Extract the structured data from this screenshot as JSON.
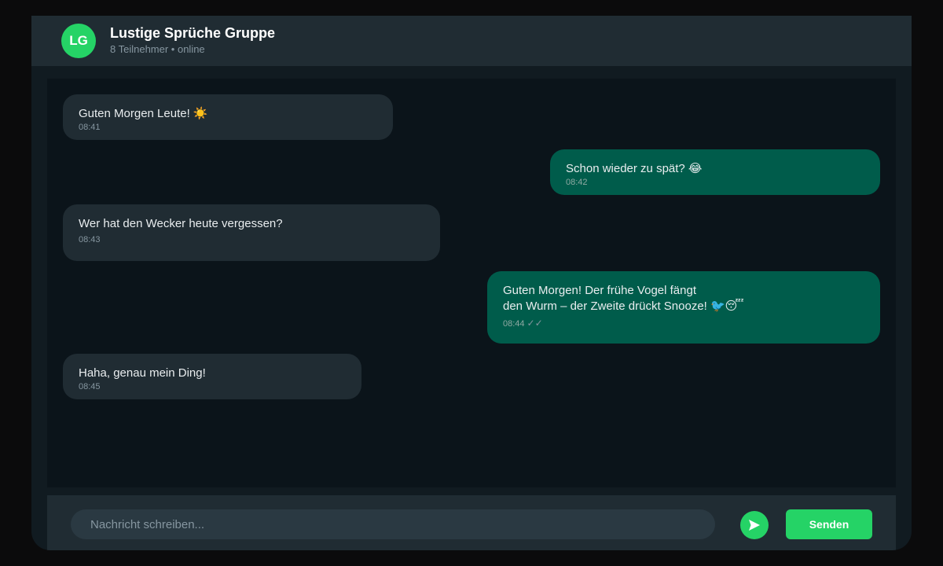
{
  "header": {
    "avatar_initials": "LG",
    "title": "Lustige Sprüche Gruppe",
    "subtitle": "8 Teilnehmer • online"
  },
  "messages": [
    {
      "direction": "incoming",
      "text": "Guten Morgen Leute! ☀️",
      "time": "08:41"
    },
    {
      "direction": "outgoing",
      "text": "Schon wieder zu spät? 😂",
      "time": "08:42"
    },
    {
      "direction": "incoming",
      "text": "Wer hat den Wecker heute vergessen?",
      "time": "08:43"
    },
    {
      "direction": "outgoing",
      "text": "Guten Morgen! Der frühe Vogel fängt\nden Wurm – der Zweite drückt Snooze! 🐦😴",
      "time": "08:44",
      "read_ticks": "✓✓"
    },
    {
      "direction": "incoming",
      "text": "Haha, genau mein Ding!",
      "time": "08:45"
    }
  ],
  "composer": {
    "placeholder": "Nachricht schreiben...",
    "value": "",
    "send_icon": "send-arrow-icon",
    "send_label": "Senden"
  },
  "colors": {
    "accent": "#25d366",
    "incoming_bubble": "#202c33",
    "outgoing_bubble": "#005c4b",
    "chat_background": "#0b141a"
  }
}
